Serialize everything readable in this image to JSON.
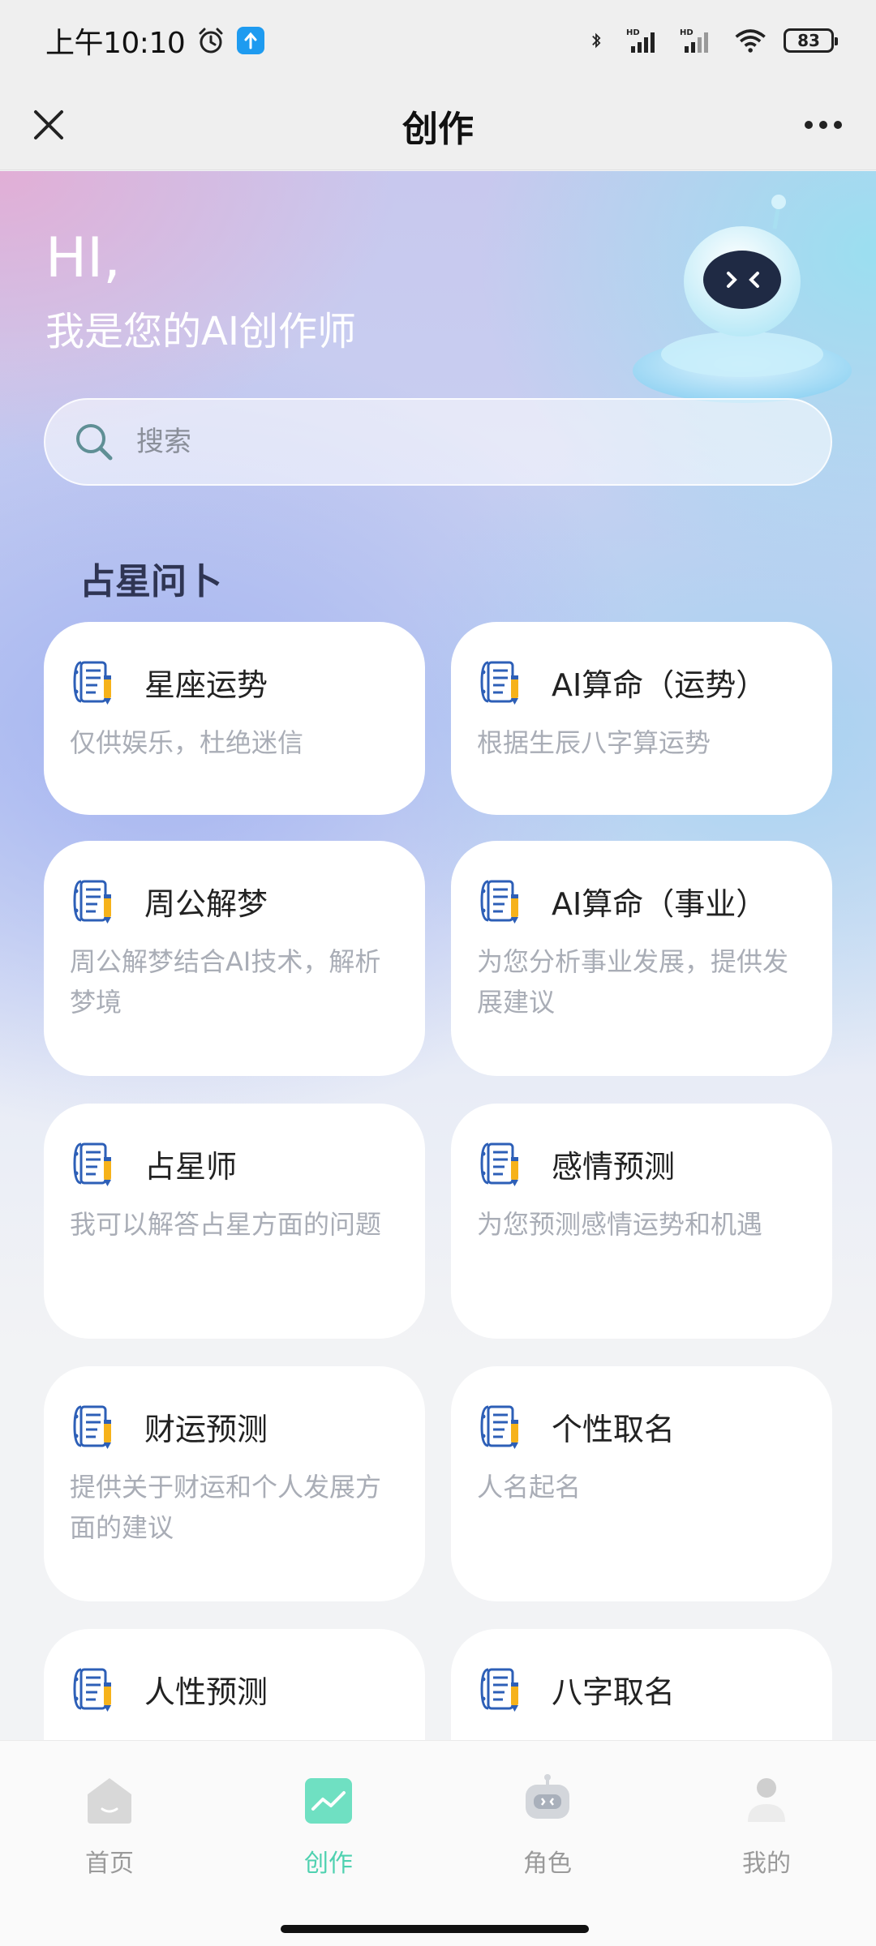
{
  "status_bar": {
    "time": "上午10:10",
    "battery": "83"
  },
  "nav": {
    "title": "创作"
  },
  "hero": {
    "hi": "HI,",
    "subtitle": "我是您的AI创作师"
  },
  "search": {
    "placeholder": "搜索"
  },
  "section": {
    "title": "占星问卜"
  },
  "cards": [
    {
      "title": "星座运势",
      "desc": "仅供娱乐，杜绝迷信"
    },
    {
      "title": "AI算命（运势）",
      "desc": "根据生辰八字算运势"
    },
    {
      "title": "周公解梦",
      "desc": "周公解梦结合AI技术，解析梦境"
    },
    {
      "title": "AI算命（事业）",
      "desc": "为您分析事业发展，提供发展建议"
    },
    {
      "title": "占星师",
      "desc": "我可以解答占星方面的问题"
    },
    {
      "title": "感情预测",
      "desc": "为您预测感情运势和机遇"
    },
    {
      "title": "财运预测",
      "desc": "提供关于财运和个人发展方面的建议"
    },
    {
      "title": "个性取名",
      "desc": "人名起名"
    },
    {
      "title": "人性预测",
      "desc": ""
    },
    {
      "title": "八字取名",
      "desc": ""
    }
  ],
  "tabs": [
    {
      "label": "首页",
      "icon": "home-icon"
    },
    {
      "label": "创作",
      "icon": "create-icon"
    },
    {
      "label": "角色",
      "icon": "robot-icon"
    },
    {
      "label": "我的",
      "icon": "profile-icon"
    }
  ],
  "colors": {
    "accent": "#4fd1b0",
    "card_bg": "#ffffff",
    "desc_text": "#a9adb6"
  }
}
